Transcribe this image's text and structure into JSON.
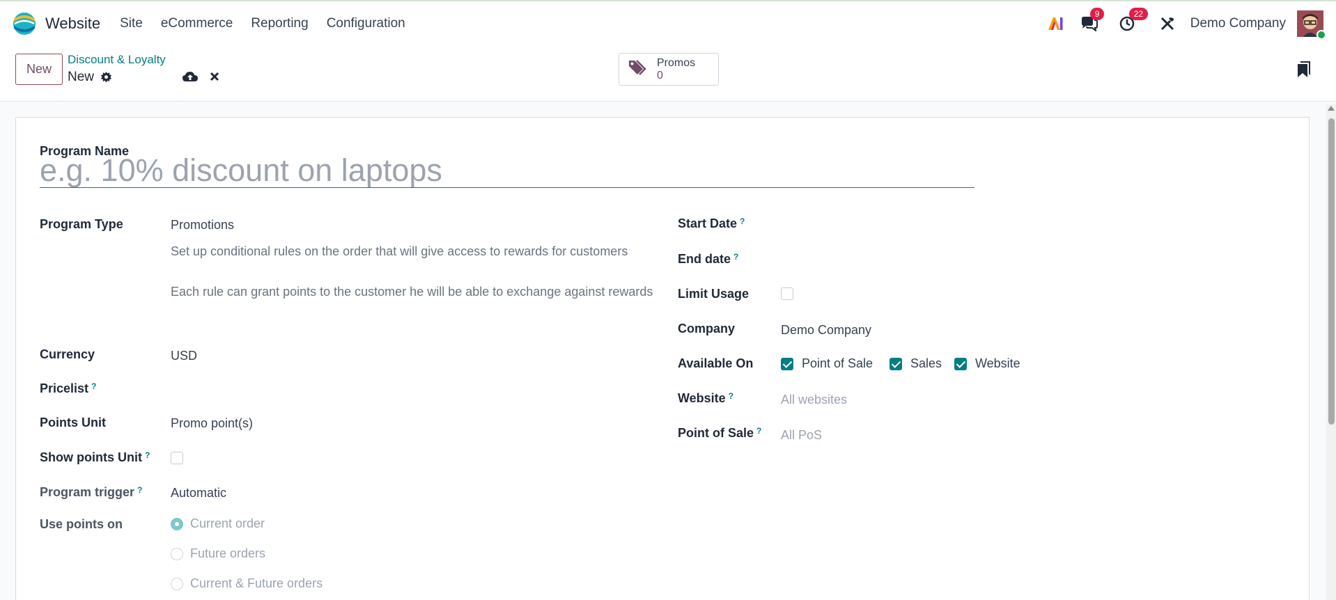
{
  "navbar": {
    "app_name": "Website",
    "menu": [
      "Site",
      "eCommerce",
      "Reporting",
      "Configuration"
    ],
    "messages_count": "9",
    "activities_count": "22",
    "company": "Demo Company"
  },
  "control": {
    "new_label": "New",
    "breadcrumb": "Discount & Loyalty",
    "record_name": "New",
    "smart_button": {
      "label": "Promos",
      "count": "0"
    }
  },
  "form": {
    "program_name_label": "Program Name",
    "program_name_placeholder": "e.g. 10% discount on laptops",
    "program_type_label": "Program Type",
    "program_type_value": "Promotions",
    "program_type_desc_1": "Set up conditional rules on the order that will give access to rewards for customers",
    "program_type_desc_2": "Each rule can grant points to the customer he will be able to exchange against rewards",
    "currency_label": "Currency",
    "currency_value": "USD",
    "pricelist_label": "Pricelist",
    "points_unit_label": "Points Unit",
    "points_unit_value": "Promo point(s)",
    "show_points_unit_label": "Show points Unit",
    "program_trigger_label": "Program trigger",
    "program_trigger_value": "Automatic",
    "use_points_label": "Use points on",
    "use_points_options": [
      "Current order",
      "Future orders",
      "Current & Future orders"
    ],
    "use_points_selected": "Current order",
    "start_date_label": "Start Date",
    "end_date_label": "End date",
    "limit_usage_label": "Limit Usage",
    "company_label": "Company",
    "company_value": "Demo Company",
    "available_on_label": "Available On",
    "available_on_options": [
      "Point of Sale",
      "Sales",
      "Website"
    ],
    "website_label": "Website",
    "website_placeholder": "All websites",
    "pos_label": "Point of Sale",
    "pos_placeholder": "All PoS",
    "help_mark": "?"
  },
  "colors": {
    "accent": "#017e84",
    "brand": "#714b67",
    "badge": "#e11d48"
  }
}
